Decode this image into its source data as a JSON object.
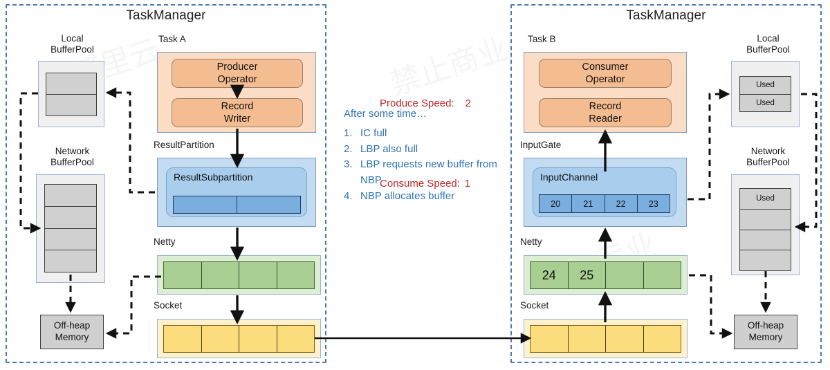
{
  "left_taskmanager": {
    "title": "TaskManager",
    "local_buffer_pool": {
      "label": "Local\nBufferPool",
      "cells": [
        "",
        ""
      ]
    },
    "network_buffer_pool": {
      "label": "Network\nBufferPool",
      "cells": [
        "",
        "",
        "",
        ""
      ]
    },
    "off_heap_memory": {
      "label": "Off-heap\nMemory"
    },
    "task": {
      "label": "Task A",
      "operators": [
        "Producer\nOperator",
        "Record\nWriter"
      ]
    },
    "result_partition": {
      "label": "ResultPartition",
      "subpartition_label": "ResultSubpartition",
      "cells": [
        "",
        ""
      ]
    },
    "netty": {
      "label": "Netty",
      "cells": [
        "",
        "",
        "",
        ""
      ]
    },
    "socket": {
      "label": "Socket",
      "cells": [
        "",
        "",
        "",
        ""
      ]
    }
  },
  "right_taskmanager": {
    "title": "TaskManager",
    "local_buffer_pool": {
      "label": "Local\nBufferPool",
      "cells": [
        "Used",
        "Used"
      ]
    },
    "network_buffer_pool": {
      "label": "Network\nBufferPool",
      "cells": [
        "Used",
        "",
        "",
        ""
      ]
    },
    "off_heap_memory": {
      "label": "Off-heap\nMemory"
    },
    "task": {
      "label": "Task B",
      "operators": [
        "Consumer\nOperator",
        "Record\nReader"
      ]
    },
    "input_gate": {
      "label": "InputGate",
      "channel_label": "InputChannel",
      "cells": [
        "20",
        "21",
        "22",
        "23"
      ]
    },
    "netty": {
      "label": "Netty",
      "cells": [
        "24",
        "25",
        "",
        ""
      ]
    },
    "socket": {
      "label": "Socket",
      "cells": [
        "",
        "",
        "",
        ""
      ]
    }
  },
  "annotations": {
    "produce_speed_label": "Produce Speed:",
    "produce_speed_value": "2",
    "consume_speed_label": "Consume Speed:",
    "consume_speed_value": "1",
    "steps_header": "After some time…",
    "steps": [
      {
        "num": "1.",
        "text": "IC full"
      },
      {
        "num": "2.",
        "text": "LBP also full"
      },
      {
        "num": "3.",
        "text": "LBP requests new buffer from NBP"
      },
      {
        "num": "4.",
        "text": "NBP allocates buffer"
      }
    ]
  },
  "colors": {
    "taskmanager_border": "#4a79b8",
    "annotation_red": "#c0272d",
    "annotation_blue": "#2e74b5",
    "operator_orange": "#f4bc91",
    "task_orange_bg": "#fbdcc4",
    "partition_blue_bg": "#c3dcf2",
    "buffer_blue": "#79aede",
    "netty_green": "#a8cf91",
    "socket_yellow": "#fbdd7e",
    "pool_grey": "#d0d0d0"
  }
}
